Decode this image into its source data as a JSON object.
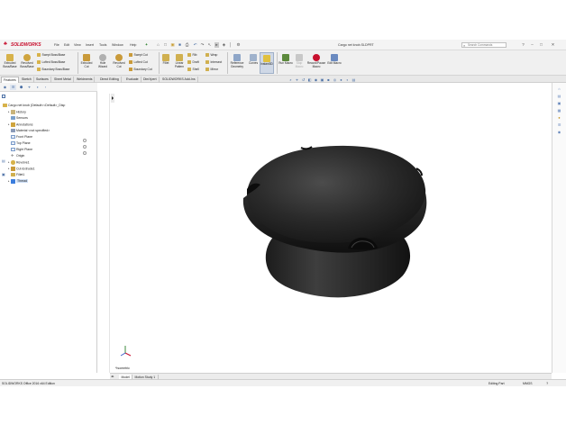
{
  "app": {
    "brand": "SOLIDWORKS",
    "document_title": "Cargo net knob.SLDPRT",
    "search_placeholder": "Search Commands"
  },
  "menu": [
    "File",
    "Edit",
    "View",
    "Insert",
    "Tools",
    "Window",
    "Help"
  ],
  "ribbon": {
    "extruded_boss": "Extruded Boss/Base",
    "revolved_boss": "Revolved Boss/Base",
    "swept_boss": "Swept Boss/Base",
    "lofted_boss": "Lofted Boss/Base",
    "boundary_boss": "Boundary Boss/Base",
    "extruded_cut": "Extruded Cut",
    "hole_wizard": "Hole Wizard",
    "revolved_cut": "Revolved Cut",
    "swept_cut": "Swept Cut",
    "lofted_cut": "Lofted Cut",
    "boundary_cut": "Boundary Cut",
    "fillet": "Fillet",
    "linear_pattern": "Linear Pattern",
    "rib": "Rib",
    "draft": "Draft",
    "shell": "Shell",
    "wrap": "Wrap",
    "intersect": "Intersect",
    "mirror": "Mirror",
    "reference_geometry": "Reference Geometry",
    "curves": "Curves",
    "instant3d": "Instant3D",
    "run_macro": "Run Macro",
    "stop_macro": "Stop Macro",
    "record_pause_macro": "Record/Pause Macro",
    "edit_macro": "Edit Macro"
  },
  "tabs": [
    "Features",
    "Sketch",
    "Surfaces",
    "Sheet Metal",
    "Weldments",
    "Direct Editing",
    "Evaluate",
    "DimXpert",
    "SOLIDWORKS Add-Ins"
  ],
  "tree": {
    "root": "Cargo net knob (Default<<Default>_Disp",
    "items": [
      "History",
      "Sensors",
      "Annotations",
      "Material <not specified>",
      "Front Plane",
      "Top Plane",
      "Right Plane",
      "Origin",
      "Revolve1",
      "Cut-Extrude1",
      "Fillet1",
      "Thread"
    ]
  },
  "viewport": {
    "view_label": "*Isometric"
  },
  "bottom_tabs": [
    "Model",
    "Motion Study 1"
  ],
  "status": {
    "edition": "SOLIDWORKS Office 2016 x64 Edition",
    "mode": "Editing Part",
    "units": "MMGS"
  },
  "colors": {
    "model_dark": "#1e1e1e",
    "model_mid": "#3a3a3a",
    "brand_red": "#c8102e",
    "selection_blue": "#3b7ddd"
  }
}
